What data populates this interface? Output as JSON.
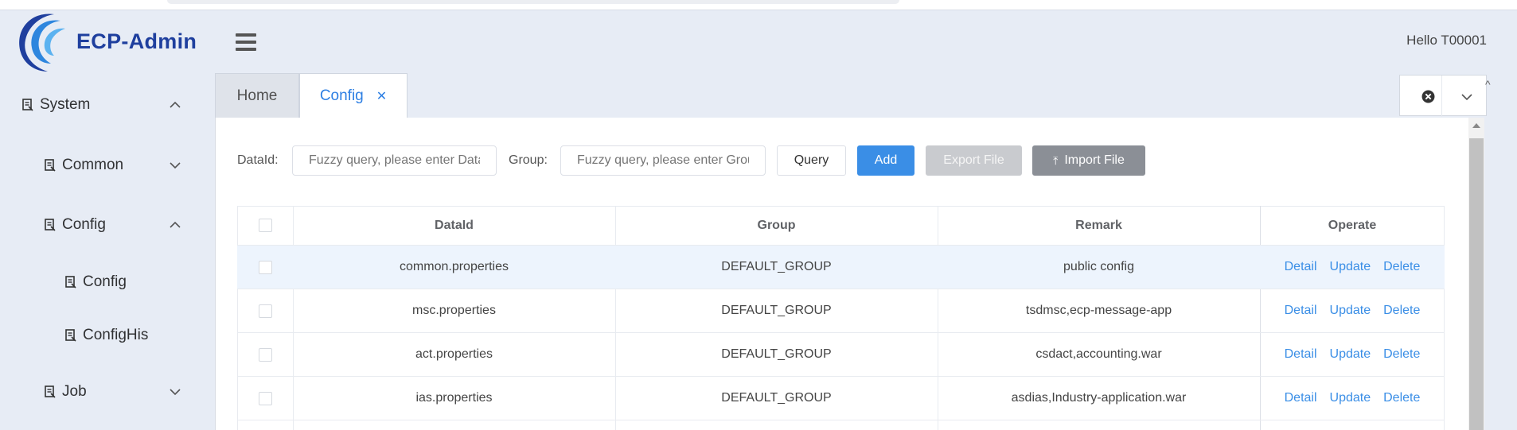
{
  "app": {
    "name": "ECP-Admin",
    "greeting": "Hello T00001"
  },
  "sidebar": {
    "items": [
      {
        "label": "System",
        "expanded": true
      },
      {
        "label": "Common",
        "expanded": false
      },
      {
        "label": "Config",
        "expanded": true
      },
      {
        "label": "Config"
      },
      {
        "label": "ConfigHis"
      },
      {
        "label": "Job",
        "expanded": false
      }
    ]
  },
  "tabs": [
    {
      "label": "Home",
      "active": false
    },
    {
      "label": "Config",
      "active": true,
      "close_icon": "close-icon"
    }
  ],
  "filters": {
    "dataid_label": "DataId:",
    "dataid_placeholder": "Fuzzy query, please enter DataId",
    "group_label": "Group:",
    "group_placeholder": "Fuzzy query, please enter Group"
  },
  "buttons": {
    "query": "Query",
    "add": "Add",
    "export": "Export File",
    "import": "Import File"
  },
  "table": {
    "columns": [
      "DataId",
      "Group",
      "Remark",
      "Operate"
    ],
    "rows": [
      {
        "dataid": "common.properties",
        "group": "DEFAULT_GROUP",
        "remark": "public config"
      },
      {
        "dataid": "msc.properties",
        "group": "DEFAULT_GROUP",
        "remark": "tsdmsc,ecp-message-app"
      },
      {
        "dataid": "act.properties",
        "group": "DEFAULT_GROUP",
        "remark": "csdact,accounting.war"
      },
      {
        "dataid": "ias.properties",
        "group": "DEFAULT_GROUP",
        "remark": "asdias,Industry-application.war"
      }
    ],
    "operations": [
      "Detail",
      "Update",
      "Delete"
    ]
  },
  "colors": {
    "accent": "#3a8ee6",
    "brand": "#1f3f9e",
    "selected_row": "#edf4fd"
  }
}
